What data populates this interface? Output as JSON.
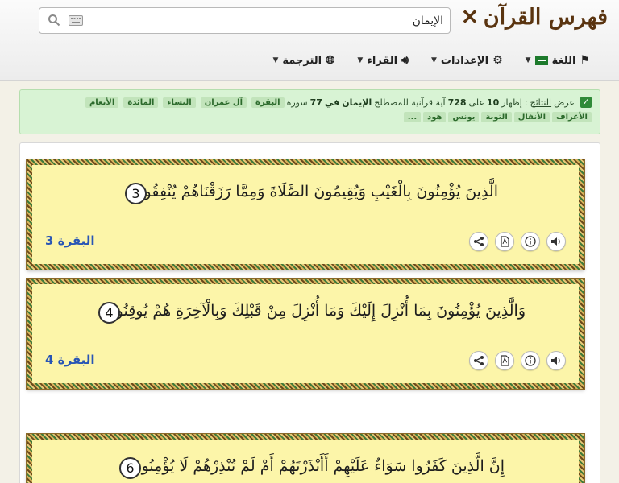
{
  "header": {
    "logo_text": "فهرس القرآن",
    "search": {
      "value": "الإيمان",
      "placeholder": ""
    },
    "nav": [
      {
        "label": "الترجمة",
        "icon": "globe-icon"
      },
      {
        "label": "القراء",
        "icon": "speaker-icon"
      },
      {
        "label": "الإعدادات",
        "icon": "gear-icon"
      },
      {
        "label": "اللغة",
        "icon": "flag-icon"
      }
    ]
  },
  "notice": {
    "lead": "عرض",
    "results_word": "النتائج",
    "colon": ":",
    "text_show": "إظهار",
    "shown": "10",
    "on": "على",
    "total": "728",
    "text_ayah": "آية قرآنية للمصطلح",
    "term": "الإيمان",
    "in": "في",
    "surah_count": "77",
    "surah_word": "سورة",
    "surahs": [
      "البقرة",
      "آل عمران",
      "النساء",
      "المائدة",
      "الأنعام",
      "الأعراف",
      "الأنفال",
      "التوبة",
      "يونس",
      "هود",
      "..."
    ]
  },
  "verses": [
    {
      "text": "الَّذِينَ يُؤْمِنُونَ بِالْغَيْبِ وَيُقِيمُونَ الصَّلَاةَ وَمِمَّا رَزَقْنَاهُمْ يُنْفِقُونَ",
      "number": "3",
      "reference": "البقرة 3"
    },
    {
      "text": "وَالَّذِينَ يُؤْمِنُونَ بِمَا أُنْزِلَ إِلَيْكَ وَمَا أُنْزِلَ مِنْ قَبْلِكَ وَبِالْآخِرَةِ هُمْ يُوقِنُونَ",
      "number": "4",
      "reference": "البقرة 4"
    },
    {
      "text": "إِنَّ الَّذِينَ كَفَرُوا سَوَاءٌ عَلَيْهِمْ أَأَنْذَرْتَهُمْ أَمْ لَمْ تُنْذِرْهُمْ لَا يُؤْمِنُونَ",
      "number": "6",
      "reference": ""
    }
  ],
  "colors": {
    "accent": "#2855b5",
    "card": "#fcf5a9",
    "notice": "#d8f3d4",
    "logo": "#5a3410"
  }
}
